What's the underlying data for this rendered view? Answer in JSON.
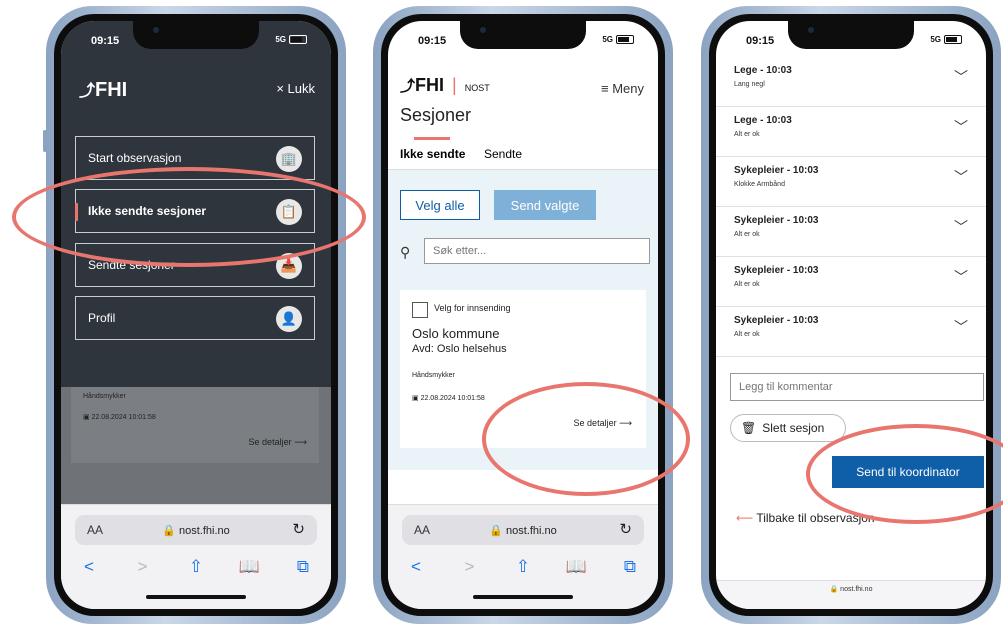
{
  "status": {
    "time": "09:15",
    "signal": "5G"
  },
  "safari": {
    "aa": "AA",
    "url": "nost.fhi.no",
    "reload": "↻",
    "back": "<",
    "forward": ">",
    "share": "⇧",
    "bookmarks": "📖",
    "tabs": "⧉"
  },
  "phone1": {
    "logo": "FHI",
    "close_label": "× Lukk",
    "menu": [
      {
        "label": "Start observasjon",
        "icon": "🏢"
      },
      {
        "label": "Ikke sendte sesjoner",
        "icon": "📋"
      },
      {
        "label": "Sendte sesjoner",
        "icon": "📥"
      },
      {
        "label": "Profil",
        "icon": "👤"
      }
    ],
    "bg_item": {
      "label": "Håndsmykker",
      "date": "22.08.2024 10:01:58",
      "details": "Se detaljer"
    }
  },
  "phone2": {
    "logo": "FHI",
    "app_name": "NOST",
    "menu_label": "Meny",
    "title": "Sesjoner",
    "tabs": [
      "Ikke sendte",
      "Sendte"
    ],
    "select_all": "Velg alle",
    "send_selected": "Send valgte",
    "search_placeholder": "Søk etter...",
    "card": {
      "checkbox_label": "Velg for innsending",
      "org": "Oslo kommune",
      "dept": "Avd: Oslo helsehus",
      "item": "Håndsmykker",
      "date": "22.08.2024 10:01:58",
      "details": "Se detaljer"
    }
  },
  "phone3": {
    "rows": [
      {
        "title": "Lege - 10:03",
        "sub": "Lang negl"
      },
      {
        "title": "Lege - 10:03",
        "sub": "Alt er ok"
      },
      {
        "title": "Sykepleier - 10:03",
        "sub": "Klokke Armbånd"
      },
      {
        "title": "Sykepleier - 10:03",
        "sub": "Alt er ok"
      },
      {
        "title": "Sykepleier - 10:03",
        "sub": "Alt er ok"
      },
      {
        "title": "Sykepleier - 10:03",
        "sub": "Alt er ok"
      }
    ],
    "comment_placeholder": "Legg til kommentar",
    "delete_label": "Slett sesjon",
    "send_label": "Send til koordinator",
    "back_label": "Tilbake til observasjon",
    "url": "nost.fhi.no"
  },
  "colors": {
    "accent": "#e8766e",
    "primary": "#0f5ea8",
    "dark": "#2f353c"
  }
}
